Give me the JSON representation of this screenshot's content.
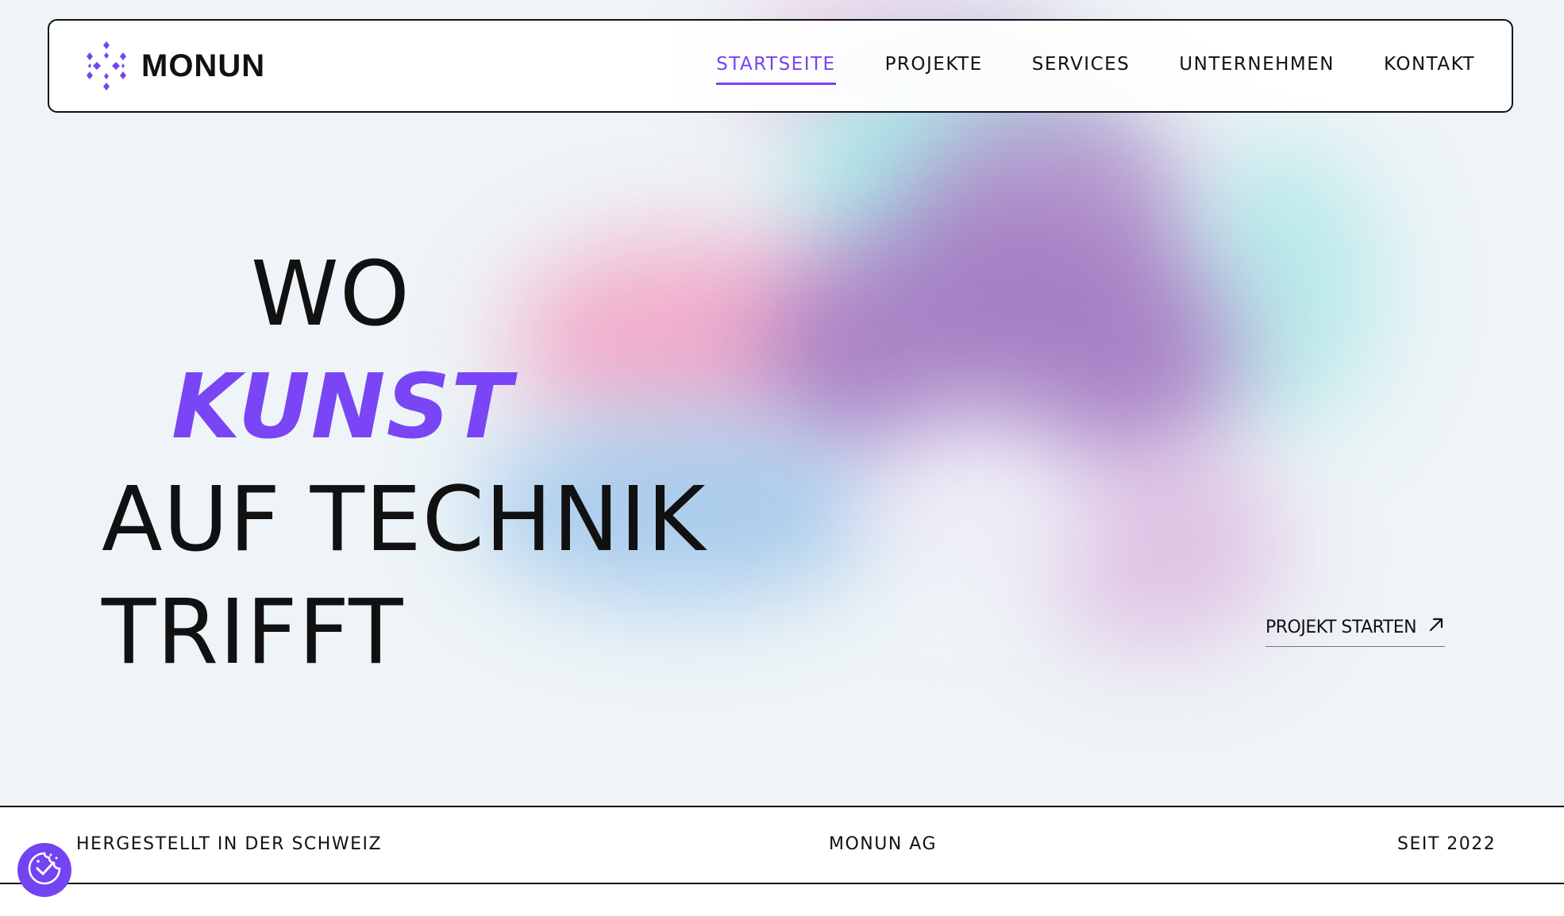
{
  "colors": {
    "accent": "#7444f2",
    "text": "#111111",
    "background": "#eef4f7"
  },
  "brand": {
    "name": "MONUN",
    "logo_icon": "diamond-grid-logo-icon"
  },
  "nav": {
    "items": [
      {
        "label": "STARTSEITE",
        "active": true
      },
      {
        "label": "PROJEKTE",
        "active": false
      },
      {
        "label": "SERVICES",
        "active": false
      },
      {
        "label": "UNTERNEHMEN",
        "active": false
      },
      {
        "label": "KONTAKT",
        "active": false
      }
    ]
  },
  "hero": {
    "line1": "WO",
    "line2": "KUNST",
    "line3": "AUF TECHNIK",
    "line4": "TRIFFT",
    "cta_label": "PROJEKT STARTEN",
    "cta_icon": "arrow-up-right-icon"
  },
  "footer": {
    "left": "HERGESTELLT IN DER SCHWEIZ",
    "center": "MONUN AG",
    "right": "SEIT 2022"
  },
  "cookie_button": {
    "icon": "cookie-consent-icon"
  }
}
